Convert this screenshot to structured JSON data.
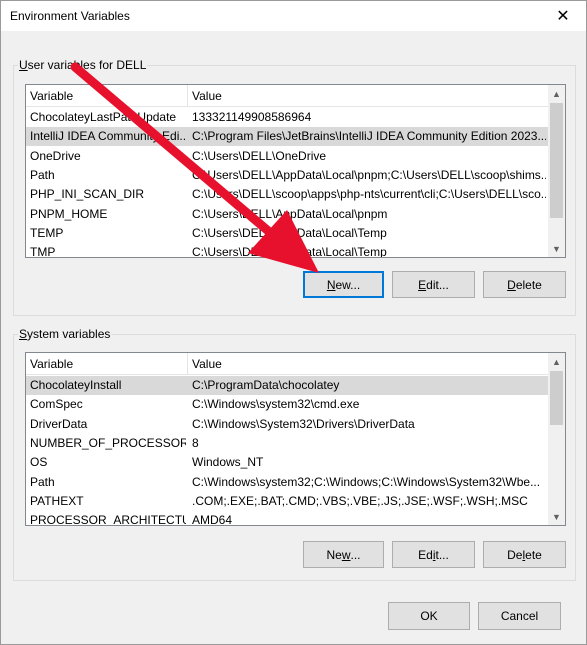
{
  "window": {
    "title": "Environment Variables",
    "close_glyph": "✕"
  },
  "user_section": {
    "label_accel": "U",
    "label_rest": "ser variables for DELL",
    "columns": [
      "Variable",
      "Value"
    ],
    "rows": [
      {
        "variable": "ChocolateyLastPathUpdate",
        "value": "133321149908586964",
        "selected": false
      },
      {
        "variable": "IntelliJ IDEA Community Edi...",
        "value": "C:\\Program Files\\JetBrains\\IntelliJ IDEA Community Edition 2023....",
        "selected": true
      },
      {
        "variable": "OneDrive",
        "value": "C:\\Users\\DELL\\OneDrive",
        "selected": false
      },
      {
        "variable": "Path",
        "value": "C:\\Users\\DELL\\AppData\\Local\\pnpm;C:\\Users\\DELL\\scoop\\shims...",
        "selected": false
      },
      {
        "variable": "PHP_INI_SCAN_DIR",
        "value": "C:\\Users\\DELL\\scoop\\apps\\php-nts\\current\\cli;C:\\Users\\DELL\\sco...",
        "selected": false
      },
      {
        "variable": "PNPM_HOME",
        "value": "C:\\Users\\DELL\\AppData\\Local\\pnpm",
        "selected": false
      },
      {
        "variable": "TEMP",
        "value": "C:\\Users\\DELL\\AppData\\Local\\Temp",
        "selected": false
      },
      {
        "variable": "TMP",
        "value": "C:\\Users\\DELL\\AppData\\Local\\Temp",
        "selected": false
      }
    ],
    "buttons": {
      "new_accel": "N",
      "new_rest": "ew...",
      "edit_accel": "E",
      "edit_rest": "dit...",
      "delete_accel": "D",
      "delete_rest": "elete"
    }
  },
  "system_section": {
    "label_accel": "S",
    "label_rest": "ystem variables",
    "columns": [
      "Variable",
      "Value"
    ],
    "rows": [
      {
        "variable": "ChocolateyInstall",
        "value": "C:\\ProgramData\\chocolatey",
        "selected": true
      },
      {
        "variable": "ComSpec",
        "value": "C:\\Windows\\system32\\cmd.exe",
        "selected": false
      },
      {
        "variable": "DriverData",
        "value": "C:\\Windows\\System32\\Drivers\\DriverData",
        "selected": false
      },
      {
        "variable": "NUMBER_OF_PROCESSORS",
        "value": "8",
        "selected": false
      },
      {
        "variable": "OS",
        "value": "Windows_NT",
        "selected": false
      },
      {
        "variable": "Path",
        "value": "C:\\Windows\\system32;C:\\Windows;C:\\Windows\\System32\\Wbe...",
        "selected": false
      },
      {
        "variable": "PATHEXT",
        "value": ".COM;.EXE;.BAT;.CMD;.VBS;.VBE;.JS;.JSE;.WSF;.WSH;.MSC",
        "selected": false
      },
      {
        "variable": "PROCESSOR_ARCHITECTURE",
        "value": "AMD64",
        "selected": false
      }
    ],
    "buttons": {
      "new_accel": "w",
      "new_pre": "Ne",
      "new_rest": "...",
      "edit_accel": "i",
      "edit_pre": "Ed",
      "edit_rest": "t...",
      "delete_accel": "l",
      "delete_pre": "De",
      "delete_rest": "ete"
    }
  },
  "footer": {
    "ok_label": "OK",
    "cancel_label": "Cancel"
  },
  "colors": {
    "annotation_arrow": "#e8112d",
    "focus_border": "#0078d7",
    "selected_row": "#d9d9d9"
  }
}
